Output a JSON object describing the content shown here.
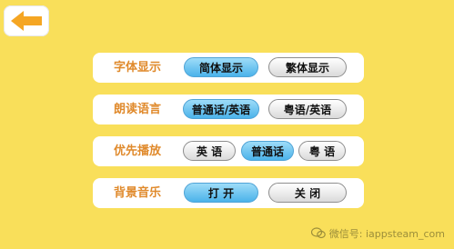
{
  "colors": {
    "background": "#F9DF5A",
    "panel": "#FFFFFF",
    "label": "#E08A2C",
    "selected": "#4BB3EA",
    "back_arrow": "#F5A623"
  },
  "back": {
    "icon": "arrow-left-icon"
  },
  "settings": [
    {
      "label": "字体显示",
      "options": [
        {
          "text": "简体显示",
          "selected": true
        },
        {
          "text": "繁体显示",
          "selected": false
        }
      ]
    },
    {
      "label": "朗读语言",
      "options": [
        {
          "text": "普通话/英语",
          "selected": true
        },
        {
          "text": "粤语/英语",
          "selected": false
        }
      ]
    },
    {
      "label": "优先播放",
      "options": [
        {
          "text": "英 语",
          "selected": false
        },
        {
          "text": "普通话",
          "selected": true
        },
        {
          "text": "粤 语",
          "selected": false
        }
      ]
    },
    {
      "label": "背景音乐",
      "options": [
        {
          "text": "打 开",
          "selected": true
        },
        {
          "text": "关 闭",
          "selected": false
        }
      ]
    }
  ],
  "watermark": {
    "text": "微信号: iappsteam_com",
    "icon": "wechat-icon"
  }
}
